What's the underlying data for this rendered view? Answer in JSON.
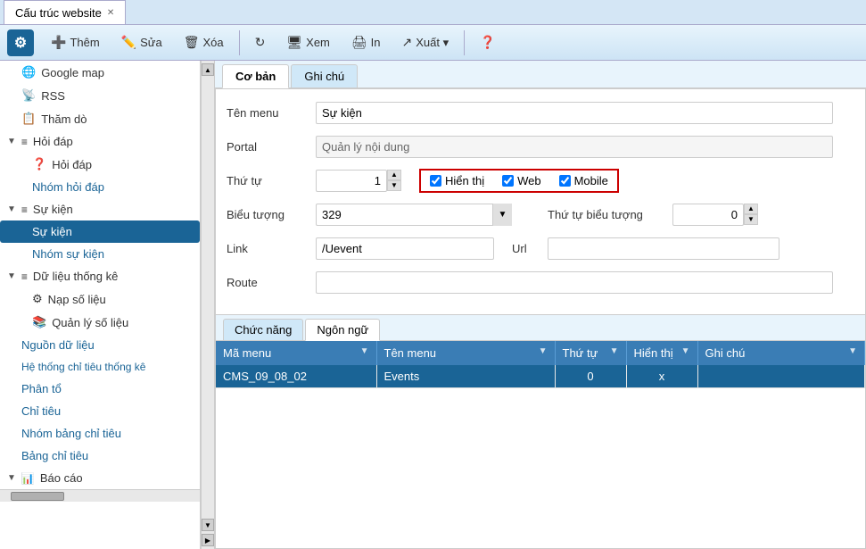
{
  "tabBar": {
    "activeTab": "Cấu trúc website",
    "tabs": [
      {
        "label": "Cấu trúc website",
        "closable": true
      }
    ]
  },
  "toolbar": {
    "logo": "⚙",
    "buttons": [
      {
        "id": "them",
        "icon": "+",
        "label": "Thêm"
      },
      {
        "id": "sua",
        "icon": "✏",
        "label": "Sửa"
      },
      {
        "id": "xoa",
        "icon": "🗑",
        "label": "Xóa"
      },
      {
        "id": "refresh",
        "icon": "↻",
        "label": ""
      },
      {
        "id": "xem",
        "icon": "🖥",
        "label": "Xem"
      },
      {
        "id": "in",
        "icon": "🖨",
        "label": "In"
      },
      {
        "id": "xuat",
        "icon": "↗",
        "label": "Xuất ▾"
      },
      {
        "id": "help",
        "icon": "?",
        "label": ""
      }
    ]
  },
  "sidebar": {
    "items": [
      {
        "id": "google-map",
        "icon": "🌐",
        "label": "Google map",
        "indent": 1,
        "level": 1
      },
      {
        "id": "rss",
        "icon": "📡",
        "label": "RSS",
        "indent": 1,
        "level": 1
      },
      {
        "id": "tham-do",
        "icon": "📋",
        "label": "Thăm dò",
        "indent": 1,
        "level": 1
      },
      {
        "id": "hoi-dap-group",
        "icon": "▼",
        "label": "Hỏi đáp",
        "indent": 0,
        "level": 0,
        "group": true
      },
      {
        "id": "hoi-dap",
        "icon": "❓",
        "label": "Hỏi đáp",
        "indent": 2,
        "level": 2
      },
      {
        "id": "nhom-hoi-dap",
        "icon": "",
        "label": "Nhóm hỏi đáp",
        "indent": 2,
        "level": 2
      },
      {
        "id": "su-kien-group",
        "icon": "▼",
        "label": "Sự kiện",
        "indent": 0,
        "level": 0,
        "group": true
      },
      {
        "id": "su-kien",
        "icon": "",
        "label": "Sự kiện",
        "indent": 2,
        "level": 2,
        "active": true
      },
      {
        "id": "nhom-su-kien",
        "icon": "",
        "label": "Nhóm sự kiện",
        "indent": 2,
        "level": 2
      },
      {
        "id": "du-lieu-group",
        "icon": "▼",
        "label": "Dữ liệu thống kê",
        "indent": 0,
        "level": 0,
        "group": true
      },
      {
        "id": "nap-so-lieu",
        "icon": "⚙",
        "label": "Nạp số liệu",
        "indent": 2,
        "level": 2
      },
      {
        "id": "quan-ly-so-lieu",
        "icon": "📚",
        "label": "Quản lý số liệu",
        "indent": 2,
        "level": 2
      },
      {
        "id": "nguon-du-lieu",
        "icon": "",
        "label": "Nguồn dữ liệu",
        "indent": 1,
        "level": 1,
        "link": true
      },
      {
        "id": "he-thong",
        "icon": "",
        "label": "Hệ thống chỉ tiêu thống kê",
        "indent": 1,
        "level": 1,
        "link": true
      },
      {
        "id": "phan-to",
        "icon": "",
        "label": "Phân tổ",
        "indent": 1,
        "level": 1,
        "link": true
      },
      {
        "id": "chi-tieu",
        "icon": "",
        "label": "Chỉ tiêu",
        "indent": 1,
        "level": 1,
        "link": true
      },
      {
        "id": "nhom-bang-chi-tieu",
        "icon": "",
        "label": "Nhóm bảng chỉ tiêu",
        "indent": 1,
        "level": 1,
        "link": true
      },
      {
        "id": "bang-chi-tieu",
        "icon": "",
        "label": "Bảng chỉ tiêu",
        "indent": 1,
        "level": 1,
        "link": true
      },
      {
        "id": "bao-cao-group",
        "icon": "▼",
        "label": "Báo cáo",
        "indent": 0,
        "level": 0,
        "group": true
      }
    ]
  },
  "formTabs": {
    "tabs": [
      "Cơ bản",
      "Ghi chú"
    ],
    "activeTab": "Cơ bản"
  },
  "form": {
    "tenMenuLabel": "Tên menu",
    "tenMenuValue": "Sự kiện",
    "portalLabel": "Portal",
    "portalValue": "Quản lý nội dung",
    "thuTuLabel": "Thứ tự",
    "thuTuValue": "1",
    "hienThiLabel": "Hiển thị",
    "webLabel": "Web",
    "mobileLabel": "Mobile",
    "bieu_tuong_label": "Biểu tượng",
    "bieu_tuong_value": "329",
    "thu_tu_bieu_tuong_label": "Thứ tự biểu tượng",
    "thu_tu_bieu_tuong_value": "0",
    "link_label": "Link",
    "link_value": "/Uevent",
    "url_label": "Url",
    "url_value": "",
    "route_label": "Route",
    "route_value": ""
  },
  "bottomTabs": {
    "tabs": [
      "Chức năng",
      "Ngôn ngữ"
    ],
    "activeTab": "Ngôn ngữ"
  },
  "table": {
    "columns": [
      {
        "id": "ma-menu",
        "label": "Mã menu"
      },
      {
        "id": "ten-menu",
        "label": "Tên menu"
      },
      {
        "id": "thu-tu",
        "label": "Thứ tự"
      },
      {
        "id": "hien-thi",
        "label": "Hiển thị"
      },
      {
        "id": "ghi-chu",
        "label": "Ghi chú"
      }
    ],
    "rows": [
      {
        "maMenu": "CMS_09_08_02",
        "tenMenu": "Events",
        "thuTu": "0",
        "hienThi": "x",
        "ghiChu": "",
        "selected": true
      }
    ]
  }
}
